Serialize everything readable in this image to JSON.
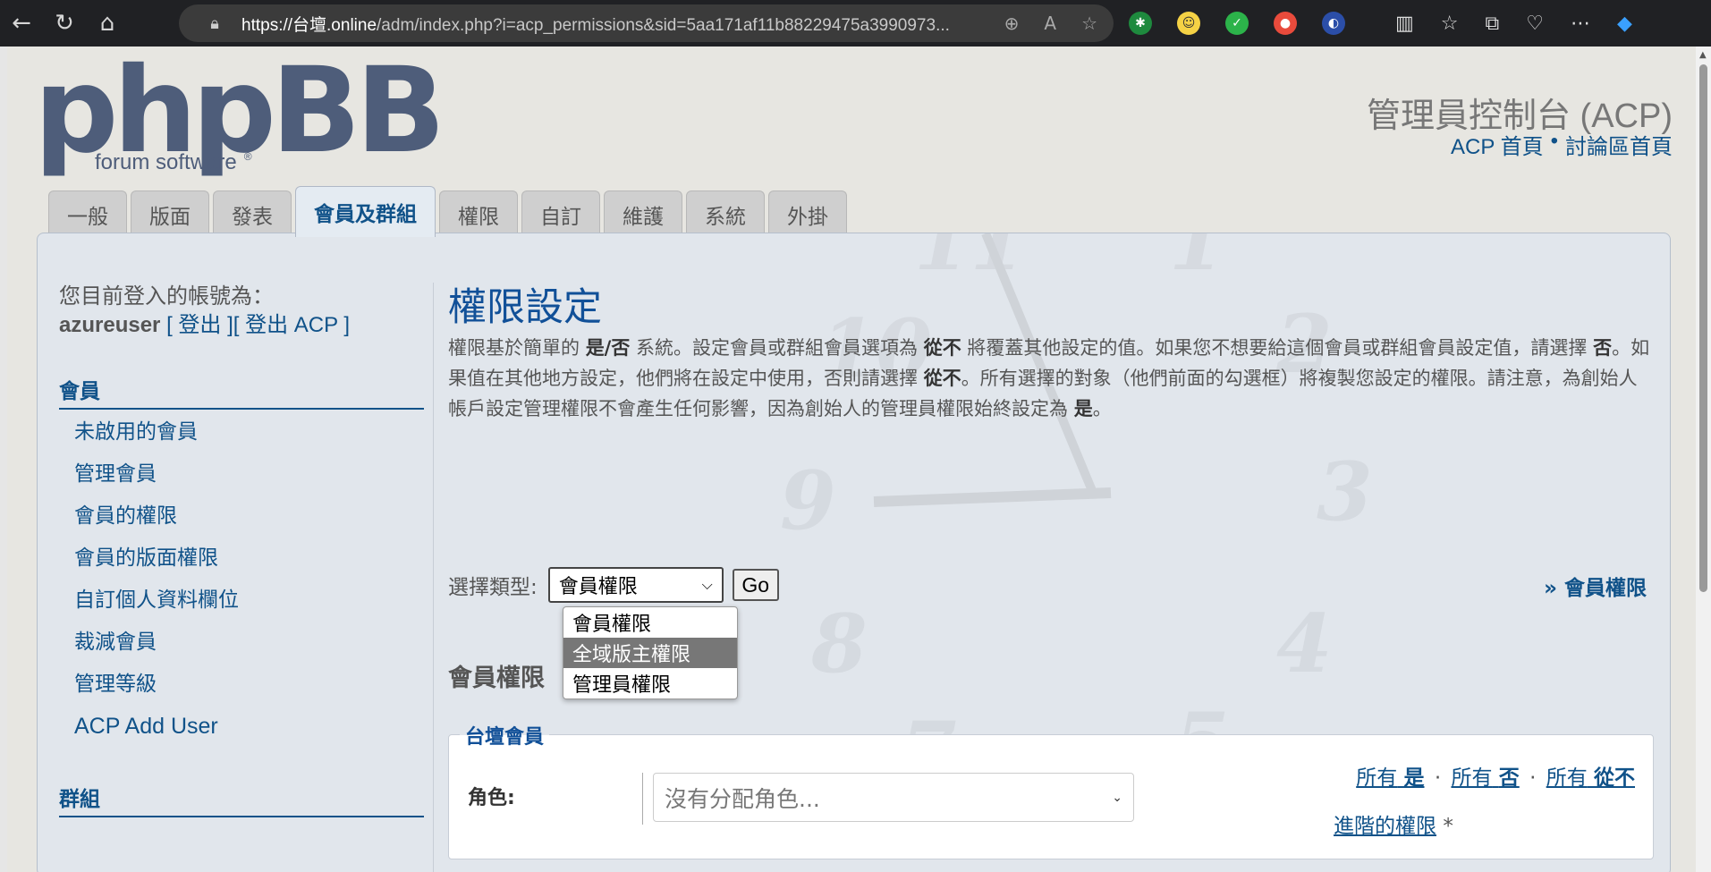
{
  "browser": {
    "url_host": "https://台壇.online",
    "url_path": "/adm/index.php?i=acp_permissions&sid=5aa171af11b88229475a3990973..."
  },
  "header": {
    "logo_text": "phpBB",
    "logo_sub": "forum software",
    "logo_reg": "®",
    "acp_title": "管理員控制台 (ACP)",
    "acp_home": "ACP 首頁",
    "bullet": "•",
    "forum_home": "討論區首頁"
  },
  "tabs": [
    "一般",
    "版面",
    "發表",
    "會員及群組",
    "權限",
    "自訂",
    "維護",
    "系統",
    "外掛"
  ],
  "active_tab": 3,
  "sidebar": {
    "logged_in_label": "您目前登入的帳號為：",
    "username": "azureuser",
    "logout_text": "[ 登出 ][ 登出 ACP ]",
    "members_heading": "會員",
    "items": [
      "未啟用的會員",
      "管理會員",
      "會員的權限",
      "會員的版面權限",
      "自訂個人資料欄位",
      "裁減會員",
      "管理等級",
      "ACP Add User"
    ],
    "groups_heading": "群組"
  },
  "main": {
    "title": "權限設定",
    "desc_1": "權限基於簡單的 ",
    "desc_yesno": "是/否",
    "desc_2": " 系統。設定會員或群組會員選項為 ",
    "desc_never1": "從不",
    "desc_3": " 將覆蓋其他設定的值。如果您不想要給這個會員或群組會員設定值，請選擇 ",
    "desc_no": "否",
    "desc_4": "。如果值在其他地方設定，他們將在設定中使用，否則請選擇 ",
    "desc_never2": "從不",
    "desc_5": "。所有選擇的對象（他們前面的勾選框）將複製您設定的權限。請注意，為創始人帳戶設定管理權限不會產生任何影響，因為創始人的管理員權限始終設定為 ",
    "desc_yes": "是",
    "desc_6": "。",
    "select_label": "選擇類型:",
    "select_value": "會員權限",
    "go_label": "Go",
    "right_link": "» 會員權限",
    "dropdown_options": [
      "會員權限",
      "全域版主權限",
      "管理員權限"
    ],
    "dropdown_highlight": 1,
    "section_title": "會員權限",
    "fieldset_legend": "台壇會員",
    "role_label": "角色:",
    "role_placeholder": "沒有分配角色...",
    "all_prefix": "所有",
    "all_yes": "是",
    "all_no": "否",
    "all_never": "從不",
    "sep": "·",
    "advanced": "進階的權限",
    "asterisk": "*"
  },
  "colors": {
    "link": "#105289",
    "title": "#115098",
    "logo": "#4e5d7a"
  }
}
